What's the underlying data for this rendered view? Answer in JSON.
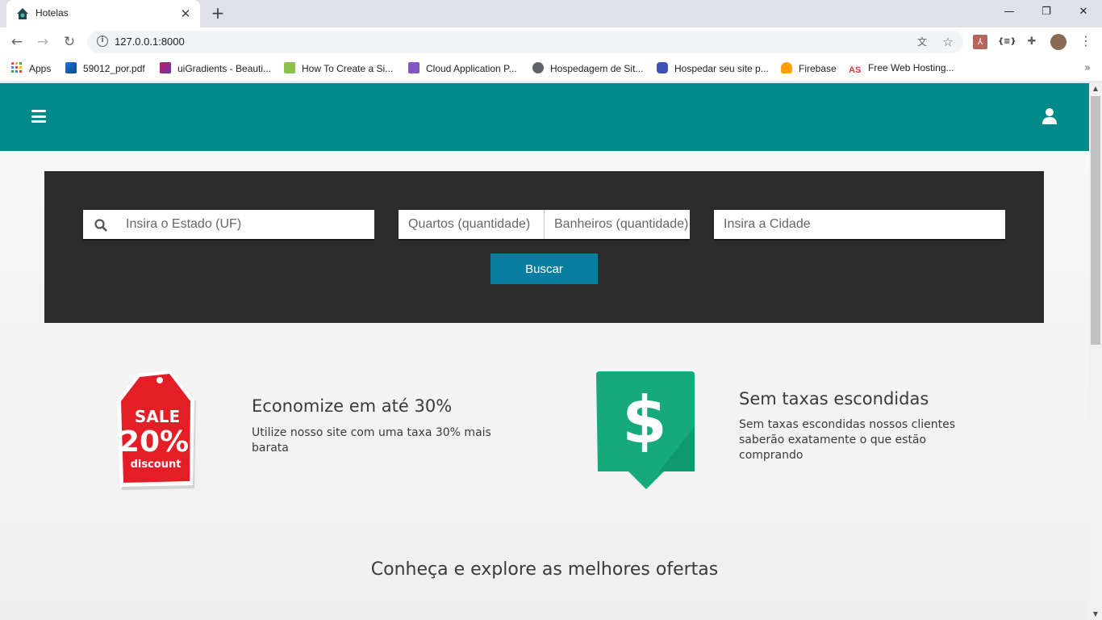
{
  "browser": {
    "tab_title": "Hotelas",
    "url": "127.0.0.1:8000",
    "bookmarks": [
      {
        "label": "Apps",
        "color": "#ea4335"
      },
      {
        "label": "59012_por.pdf",
        "color": "#1a73e8"
      },
      {
        "label": "uiGradients - Beauti...",
        "color": "#c2185b"
      },
      {
        "label": "How To Create a Si...",
        "color": "#8bc34a"
      },
      {
        "label": "Cloud Application P...",
        "color": "#7e57c2"
      },
      {
        "label": "Hospedagem de Sit...",
        "color": "#5f6368"
      },
      {
        "label": "Hospedar seu site p...",
        "color": "#3f51b5"
      },
      {
        "label": "Firebase",
        "color": "#ffa000"
      },
      {
        "label": "Free Web Hosting...",
        "color": "#e53935"
      }
    ],
    "bookmark_icons": {
      "apps": "apps-grid-icon",
      "pdf": "file-icon",
      "globe": "globe-icon",
      "firebase": "flame-icon",
      "as": "as-logo-icon"
    },
    "ext_label": "{≡}",
    "more_label": "»"
  },
  "header": {
    "bg_color": "#008b8b"
  },
  "search": {
    "estado_placeholder": "Insira o Estado (UF)",
    "quartos_placeholder": "Quartos (quantidade)",
    "banheiros_placeholder": "Banheiros (quantidade)",
    "cidade_placeholder": "Insira a Cidade",
    "button_label": "Buscar"
  },
  "features": [
    {
      "title": "Economize em até 30%",
      "text": "Utilize nosso site com uma taxa 30% mais barata",
      "badge_line1": "SALE",
      "badge_line2": "20%",
      "badge_line3": "discount"
    },
    {
      "title": "Sem taxas escondidas",
      "text": "Sem taxas escondidas nossos clientes saberão exatamente o que estão comprando",
      "badge_symbol": "$"
    }
  ],
  "offers_title": "Conheça e explore as melhores ofertas"
}
